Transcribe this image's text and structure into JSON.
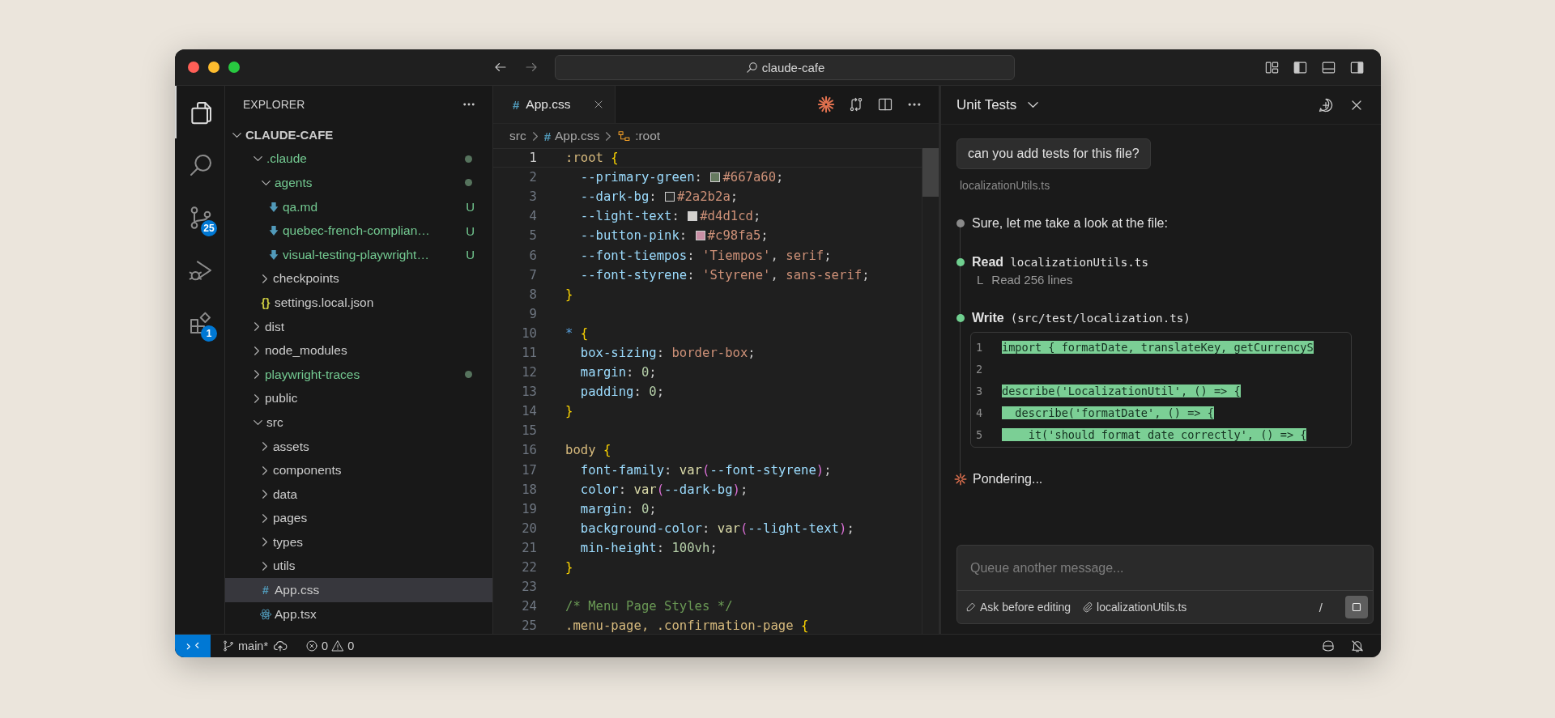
{
  "title_bar": {
    "search": "claude-cafe"
  },
  "activity_bar": [
    {
      "kind": "files",
      "selected": true
    },
    {
      "kind": "search",
      "selected": false
    },
    {
      "kind": "source-control",
      "selected": false,
      "badge": "25"
    },
    {
      "kind": "run-debug",
      "selected": false
    },
    {
      "kind": "extensions",
      "selected": false,
      "badge": "1"
    }
  ],
  "explorer": {
    "title": "EXPLORER",
    "tree": [
      {
        "label": "CLAUDE-CAFE",
        "kind": "root",
        "expanded": true,
        "selected": false,
        "untracked": false,
        "has_changes": false,
        "children": [
          {
            "label": ".claude",
            "kind": "folder",
            "expanded": true,
            "selected": false,
            "untracked": true,
            "has_changes": true,
            "children": [
              {
                "label": "agents",
                "kind": "folder",
                "expanded": true,
                "selected": false,
                "untracked": true,
                "has_changes": true,
                "children": [
                  {
                    "label": "qa.md",
                    "kind": "markdown",
                    "selected": false,
                    "untracked": true,
                    "has_changes": false,
                    "status": "U"
                  },
                  {
                    "label": "quebec-french-complian…",
                    "kind": "markdown",
                    "selected": false,
                    "untracked": true,
                    "has_changes": false,
                    "status": "U"
                  },
                  {
                    "label": "visual-testing-playwright…",
                    "kind": "markdown",
                    "selected": false,
                    "untracked": true,
                    "has_changes": false,
                    "status": "U"
                  }
                ]
              },
              {
                "label": "checkpoints",
                "kind": "folder",
                "expanded": false,
                "selected": false,
                "untracked": false,
                "has_changes": false
              },
              {
                "label": "settings.local.json",
                "kind": "json",
                "icon": "{}",
                "selected": false,
                "untracked": false,
                "has_changes": false
              }
            ]
          },
          {
            "label": "dist",
            "kind": "folder",
            "expanded": false,
            "selected": false,
            "untracked": false,
            "has_changes": false
          },
          {
            "label": "node_modules",
            "kind": "folder",
            "expanded": false,
            "selected": false,
            "untracked": false,
            "has_changes": false
          },
          {
            "label": "playwright-traces",
            "kind": "folder",
            "expanded": false,
            "selected": false,
            "untracked": true,
            "has_changes": true
          },
          {
            "label": "public",
            "kind": "folder",
            "expanded": false,
            "selected": false,
            "untracked": false,
            "has_changes": false
          },
          {
            "label": "src",
            "kind": "folder",
            "expanded": true,
            "selected": false,
            "untracked": false,
            "has_changes": false,
            "children": [
              {
                "label": "assets",
                "kind": "folder",
                "expanded": false,
                "selected": false,
                "untracked": false,
                "has_changes": false
              },
              {
                "label": "components",
                "kind": "folder",
                "expanded": false,
                "selected": false,
                "untracked": false,
                "has_changes": false
              },
              {
                "label": "data",
                "kind": "folder",
                "expanded": false,
                "selected": false,
                "untracked": false,
                "has_changes": false
              },
              {
                "label": "pages",
                "kind": "folder",
                "expanded": false,
                "selected": false,
                "untracked": false,
                "has_changes": false
              },
              {
                "label": "types",
                "kind": "folder",
                "expanded": false,
                "selected": false,
                "untracked": false,
                "has_changes": false
              },
              {
                "label": "utils",
                "kind": "folder",
                "expanded": false,
                "selected": false,
                "untracked": false,
                "has_changes": false
              },
              {
                "label": "App.css",
                "kind": "css",
                "icon": "#",
                "selected": true,
                "untracked": false,
                "has_changes": false
              },
              {
                "label": "App.tsx",
                "kind": "react",
                "selected": false,
                "untracked": false,
                "has_changes": false
              }
            ]
          }
        ]
      }
    ]
  },
  "editor": {
    "tabs": [
      {
        "label": "App.css",
        "icon": "#",
        "selected": true
      }
    ],
    "breadcrumbs": [
      {
        "kind": "folder",
        "label": "src"
      },
      {
        "kind": "css",
        "icon": "#",
        "label": "App.css"
      },
      {
        "kind": "symbol",
        "label": ":root"
      }
    ],
    "lines": [
      {
        "number": "1",
        "current": true,
        "tokens": [
          {
            "kind": "sel",
            "text": ":root"
          },
          {
            "kind": "brace",
            "text": " {"
          }
        ]
      },
      {
        "number": "2",
        "current": false,
        "tokens": [
          {
            "kind": "prop",
            "text": "  --primary-green"
          },
          {
            "kind": "punc",
            "text": ": "
          },
          {
            "kind": "swatch",
            "color": "#667a60"
          },
          {
            "kind": "str",
            "text": "#667a60"
          },
          {
            "kind": "punc",
            "text": ";"
          }
        ]
      },
      {
        "number": "3",
        "current": false,
        "tokens": [
          {
            "kind": "prop",
            "text": "  --dark-bg"
          },
          {
            "kind": "punc",
            "text": ": "
          },
          {
            "kind": "swatch",
            "color": "#2a2b2a"
          },
          {
            "kind": "str",
            "text": "#2a2b2a"
          },
          {
            "kind": "punc",
            "text": ";"
          }
        ]
      },
      {
        "number": "4",
        "current": false,
        "tokens": [
          {
            "kind": "prop",
            "text": "  --light-text"
          },
          {
            "kind": "punc",
            "text": ": "
          },
          {
            "kind": "swatch",
            "color": "#d4d1cd"
          },
          {
            "kind": "str",
            "text": "#d4d1cd"
          },
          {
            "kind": "punc",
            "text": ";"
          }
        ]
      },
      {
        "number": "5",
        "current": false,
        "tokens": [
          {
            "kind": "prop",
            "text": "  --button-pink"
          },
          {
            "kind": "punc",
            "text": ": "
          },
          {
            "kind": "swatch",
            "color": "#c98fa5"
          },
          {
            "kind": "str",
            "text": "#c98fa5"
          },
          {
            "kind": "punc",
            "text": ";"
          }
        ]
      },
      {
        "number": "6",
        "current": false,
        "tokens": [
          {
            "kind": "prop",
            "text": "  --font-tiempos"
          },
          {
            "kind": "punc",
            "text": ": "
          },
          {
            "kind": "str",
            "text": "'Tiempos'"
          },
          {
            "kind": "punc",
            "text": ", "
          },
          {
            "kind": "str",
            "text": "serif"
          },
          {
            "kind": "punc",
            "text": ";"
          }
        ]
      },
      {
        "number": "7",
        "current": false,
        "tokens": [
          {
            "kind": "prop",
            "text": "  --font-styrene"
          },
          {
            "kind": "punc",
            "text": ": "
          },
          {
            "kind": "str",
            "text": "'Styrene'"
          },
          {
            "kind": "punc",
            "text": ", "
          },
          {
            "kind": "str",
            "text": "sans-serif"
          },
          {
            "kind": "punc",
            "text": ";"
          }
        ]
      },
      {
        "number": "8",
        "current": false,
        "tokens": [
          {
            "kind": "brace",
            "text": "}"
          }
        ]
      },
      {
        "number": "9",
        "current": false
      },
      {
        "number": "10",
        "current": false,
        "tokens": [
          {
            "kind": "star",
            "text": "*"
          },
          {
            "kind": "brace",
            "text": " {"
          }
        ]
      },
      {
        "number": "11",
        "current": false,
        "tokens": [
          {
            "kind": "prop",
            "text": "  box-sizing"
          },
          {
            "kind": "punc",
            "text": ": "
          },
          {
            "kind": "str",
            "text": "border-box"
          },
          {
            "kind": "punc",
            "text": ";"
          }
        ]
      },
      {
        "number": "12",
        "current": false,
        "tokens": [
          {
            "kind": "prop",
            "text": "  margin"
          },
          {
            "kind": "punc",
            "text": ": "
          },
          {
            "kind": "num",
            "text": "0"
          },
          {
            "kind": "punc",
            "text": ";"
          }
        ]
      },
      {
        "number": "13",
        "current": false,
        "tokens": [
          {
            "kind": "prop",
            "text": "  padding"
          },
          {
            "kind": "punc",
            "text": ": "
          },
          {
            "kind": "num",
            "text": "0"
          },
          {
            "kind": "punc",
            "text": ";"
          }
        ]
      },
      {
        "number": "14",
        "current": false,
        "tokens": [
          {
            "kind": "brace",
            "text": "}"
          }
        ]
      },
      {
        "number": "15",
        "current": false
      },
      {
        "number": "16",
        "current": false,
        "tokens": [
          {
            "kind": "sel",
            "text": "body"
          },
          {
            "kind": "brace",
            "text": " {"
          }
        ]
      },
      {
        "number": "17",
        "current": false,
        "tokens": [
          {
            "kind": "prop",
            "text": "  font-family"
          },
          {
            "kind": "punc",
            "text": ": "
          },
          {
            "kind": "fn",
            "text": "var"
          },
          {
            "kind": "paren",
            "text": "("
          },
          {
            "kind": "var",
            "text": "--font-styrene"
          },
          {
            "kind": "paren",
            "text": ")"
          },
          {
            "kind": "punc",
            "text": ";"
          }
        ]
      },
      {
        "number": "18",
        "current": false,
        "tokens": [
          {
            "kind": "prop",
            "text": "  color"
          },
          {
            "kind": "punc",
            "text": ": "
          },
          {
            "kind": "fn",
            "text": "var"
          },
          {
            "kind": "paren",
            "text": "("
          },
          {
            "kind": "var",
            "text": "--dark-bg"
          },
          {
            "kind": "paren",
            "text": ")"
          },
          {
            "kind": "punc",
            "text": ";"
          }
        ]
      },
      {
        "number": "19",
        "current": false,
        "tokens": [
          {
            "kind": "prop",
            "text": "  margin"
          },
          {
            "kind": "punc",
            "text": ": "
          },
          {
            "kind": "num",
            "text": "0"
          },
          {
            "kind": "punc",
            "text": ";"
          }
        ]
      },
      {
        "number": "20",
        "current": false,
        "tokens": [
          {
            "kind": "prop",
            "text": "  background-color"
          },
          {
            "kind": "punc",
            "text": ": "
          },
          {
            "kind": "fn",
            "text": "var"
          },
          {
            "kind": "paren",
            "text": "("
          },
          {
            "kind": "var",
            "text": "--light-text"
          },
          {
            "kind": "paren",
            "text": ")"
          },
          {
            "kind": "punc",
            "text": ";"
          }
        ]
      },
      {
        "number": "21",
        "current": false,
        "tokens": [
          {
            "kind": "prop",
            "text": "  min-height"
          },
          {
            "kind": "punc",
            "text": ": "
          },
          {
            "kind": "num",
            "text": "100vh"
          },
          {
            "kind": "punc",
            "text": ";"
          }
        ]
      },
      {
        "number": "22",
        "current": false,
        "tokens": [
          {
            "kind": "brace",
            "text": "}"
          }
        ]
      },
      {
        "number": "23",
        "current": false
      },
      {
        "number": "24",
        "current": false,
        "tokens": [
          {
            "kind": "cmt",
            "text": "/* Menu Page Styles */"
          }
        ]
      },
      {
        "number": "25",
        "current": false,
        "tokens": [
          {
            "kind": "sel",
            "text": ".menu-page, .confirmation-page"
          },
          {
            "kind": "brace",
            "text": " {"
          }
        ]
      }
    ]
  },
  "chat": {
    "title": "Unit Tests",
    "user_message": "can you add tests for this file?",
    "context_file": "localizationUtils.ts",
    "steps": [
      {
        "kind": "text",
        "color": "#8a8a8a",
        "text": "Sure, let me take a look at the file:"
      },
      {
        "kind": "tool",
        "color": "#6fcf8f",
        "tool": "Read",
        "argument": "localizationUtils.ts",
        "connector": "L",
        "result": "Read 256 lines"
      },
      {
        "kind": "diff",
        "color": "#6fcf8f",
        "tool": "Write",
        "argument": "(src/test/localization.ts)",
        "lines": [
          {
            "number": "1",
            "text": "import { formatDate, translateKey, getCurrencyS"
          },
          {
            "number": "2"
          },
          {
            "number": "3",
            "text": "describe('LocalizationUtil', () => {"
          },
          {
            "number": "4",
            "text": "  describe('formatDate', () => {"
          },
          {
            "number": "5",
            "text": "    it('should format date correctly', () => {"
          }
        ]
      }
    ],
    "status": "Pondering...",
    "input": {
      "placeholder": "Queue another message..."
    },
    "mode": "Ask before editing",
    "attachment": "localizationUtils.ts",
    "command": "/"
  },
  "status_bar": {
    "branch": "main*",
    "errors": "0",
    "warnings": "0"
  }
}
